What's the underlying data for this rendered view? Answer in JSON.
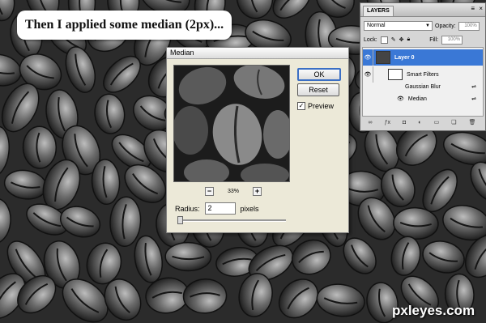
{
  "caption": {
    "text": "Then I applied some median (2px)..."
  },
  "median_dialog": {
    "title": "Median",
    "ok_label": "OK",
    "reset_label": "Reset",
    "preview_label": "Preview",
    "preview_checked": true,
    "zoom_out_symbol": "−",
    "zoom_in_symbol": "+",
    "zoom_level": "33%",
    "radius_label": "Radius:",
    "radius_value": "2",
    "radius_unit": "pixels"
  },
  "layers_panel": {
    "tab_label": "LAYERS",
    "blend_mode": "Normal",
    "opacity_label": "Opacity:",
    "opacity_value": "100%",
    "lock_label": "Lock:",
    "fill_label": "Fill:",
    "fill_value": "100%",
    "layers": [
      {
        "name": "Layer 0",
        "selected": true
      },
      {
        "name": "Smart Filters",
        "selected": false
      },
      {
        "name": "Gaussian Blur",
        "selected": false
      },
      {
        "name": "Median",
        "selected": false
      }
    ]
  },
  "watermark": {
    "text": "pxleyes.com"
  }
}
